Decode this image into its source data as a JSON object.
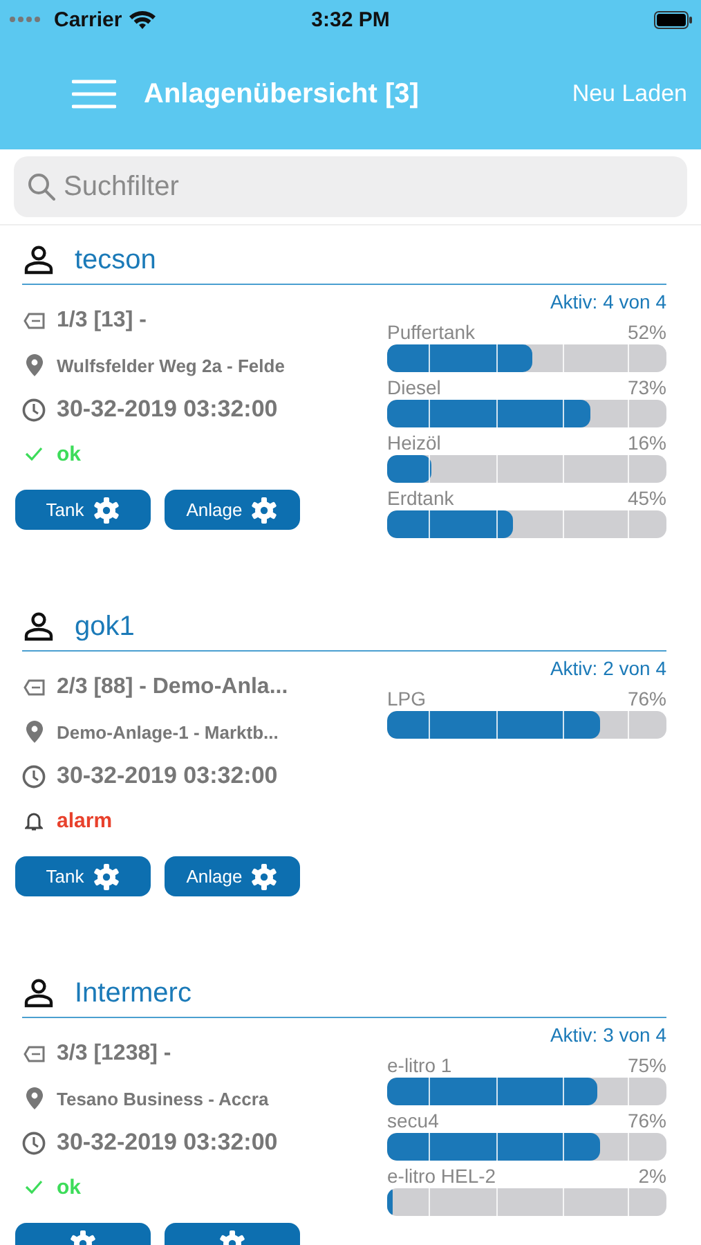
{
  "status_bar": {
    "carrier": "Carrier",
    "time": "3:32 PM"
  },
  "nav": {
    "title": "Anlagenübersicht [3]",
    "action": "Neu Laden"
  },
  "search": {
    "placeholder": "Suchfilter"
  },
  "plants": [
    {
      "name": "tecson",
      "active": "Aktiv: 4 von 4",
      "id": "1/3 [13] -",
      "address": "Wulfsfelder Weg 2a - Felde",
      "timestamp": "30-32-2019 03:32:00",
      "status": {
        "kind": "ok",
        "text": "ok"
      },
      "tanks": [
        {
          "name": "Puffertank",
          "reading": "52%",
          "level": 0.52
        },
        {
          "name": "Diesel",
          "reading": "73%",
          "level": 0.73
        },
        {
          "name": "Heizöl",
          "reading": "16%",
          "level": 0.16
        },
        {
          "name": "Erdtank",
          "reading": "45%",
          "level": 0.45
        }
      ],
      "buttons": [
        {
          "kind": "settings",
          "label": "Tank"
        },
        {
          "kind": "settings",
          "label": "Anlage"
        }
      ]
    },
    {
      "name": "gok1",
      "active": "Aktiv: 2 von 4",
      "id": "2/3 [88] - Demo-Anla...",
      "address": "Demo-Anlage-1 - Marktb...",
      "timestamp": "30-32-2019 03:32:00",
      "status": {
        "kind": "alarm",
        "text": "alarm"
      },
      "tanks": [
        {
          "name": "LPG",
          "reading": "76%",
          "level": 0.76
        }
      ],
      "buttons": [
        {
          "kind": "settings",
          "label": "Tank"
        },
        {
          "kind": "settings",
          "label": "Anlage"
        }
      ]
    },
    {
      "name": "Intermerc",
      "active": "Aktiv: 3 von 4",
      "id": "3/3 [1238] -",
      "address": "Tesano Business - Accra",
      "timestamp": "30-32-2019 03:32:00",
      "status": {
        "kind": "ok",
        "text": "ok"
      },
      "tanks": [
        {
          "name": "e-litro 1",
          "reading": "75%",
          "level": 0.75
        },
        {
          "name": "secu4",
          "reading": "76%",
          "level": 0.76
        },
        {
          "name": "e-litro HEL-2",
          "reading": "2%",
          "level": 0.02
        }
      ],
      "buttons": [
        {
          "kind": "settings"
        },
        {
          "kind": "settings"
        }
      ]
    }
  ]
}
